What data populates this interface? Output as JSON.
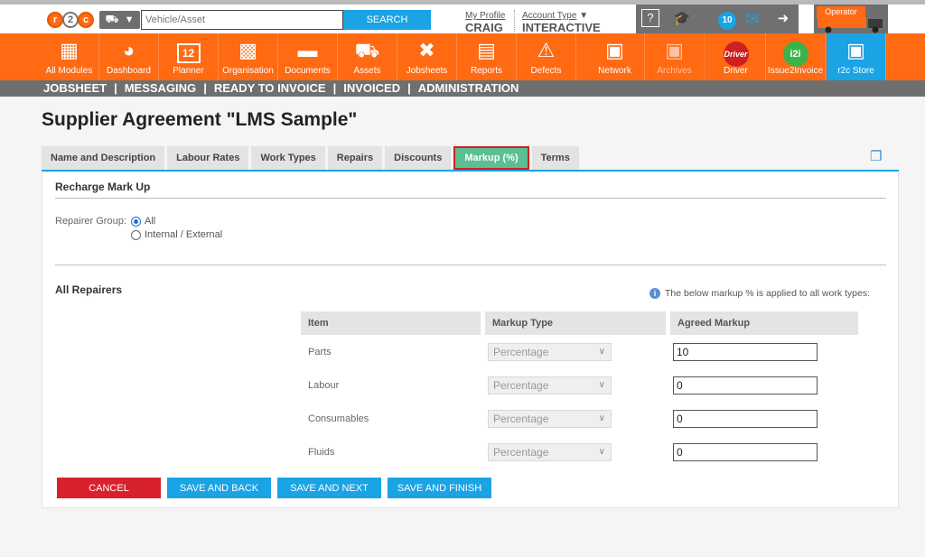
{
  "topbar": {
    "logo": [
      "r",
      "2",
      "c"
    ],
    "search_placeholder": "Vehicle/Asset",
    "search_label": "SEARCH",
    "profile_link": "My Profile",
    "profile_name": "CRAIG",
    "account_link": "Account Type",
    "account_value": "INTERACTIVE",
    "notification_count": "10",
    "operator_label": "Operator"
  },
  "modules": [
    {
      "label": "All Modules",
      "icon": "grid-icon"
    },
    {
      "label": "Dashboard",
      "icon": "gauge-icon"
    },
    {
      "label": "Planner",
      "icon": "calendar-icon",
      "badge": "12"
    },
    {
      "label": "Organisation",
      "icon": "buildings-icon"
    },
    {
      "label": "Documents",
      "icon": "folder-icon"
    },
    {
      "label": "Assets",
      "icon": "truck-icon"
    },
    {
      "label": "Jobsheets",
      "icon": "tools-icon"
    },
    {
      "label": "Reports",
      "icon": "clipboard-icon"
    },
    {
      "label": "Defects",
      "icon": "warning-icon"
    },
    {
      "label": "Network",
      "icon": "contacts-icon"
    },
    {
      "label": "Archives",
      "icon": "archive-icon"
    },
    {
      "label": "Driver",
      "icon": "driver-icon",
      "badge": "Driver"
    },
    {
      "label": "Issue2Invoice",
      "icon": "i2i-icon",
      "badge": "i2i"
    },
    {
      "label": "r2c Store",
      "icon": "store-icon"
    }
  ],
  "subnav": [
    "JOBSHEET",
    "MESSAGING",
    "READY TO INVOICE",
    "INVOICED",
    "ADMINISTRATION"
  ],
  "page": {
    "title": "Supplier Agreement \"LMS Sample\"",
    "tabs": [
      "Name and Description",
      "Labour Rates",
      "Work Types",
      "Repairs",
      "Discounts",
      "Markup (%)",
      "Terms"
    ],
    "active_tab": "Markup (%)"
  },
  "recharge": {
    "section_title": "Recharge Mark Up",
    "group_label": "Repairer Group:",
    "options": [
      "All",
      "Internal / External"
    ],
    "selected": "All"
  },
  "repairers": {
    "section_title": "All Repairers",
    "info_note": "The below markup % is applied to all work types:",
    "columns": [
      "Item",
      "Markup Type",
      "Agreed Markup"
    ],
    "rows": [
      {
        "item": "Parts",
        "type": "Percentage",
        "markup": "10"
      },
      {
        "item": "Labour",
        "type": "Percentage",
        "markup": "0"
      },
      {
        "item": "Consumables",
        "type": "Percentage",
        "markup": "0"
      },
      {
        "item": "Fluids",
        "type": "Percentage",
        "markup": "0"
      }
    ]
  },
  "actions": {
    "cancel": "CANCEL",
    "save_back": "SAVE AND BACK",
    "save_next": "SAVE AND NEXT",
    "save_finish": "SAVE AND FINISH"
  },
  "colors": {
    "brand_orange": "#ff6a13",
    "accent_blue": "#1aa3e5",
    "active_tab": "#5bbf91",
    "cancel_red": "#d8212c"
  }
}
